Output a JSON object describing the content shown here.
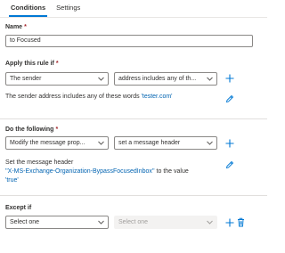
{
  "tabs": [
    {
      "label": "Conditions"
    },
    {
      "label": "Settings"
    }
  ],
  "name": {
    "label": "Name",
    "required": "*",
    "value": "to Focused"
  },
  "apply_rule": {
    "label": "Apply this rule if",
    "required": "*",
    "field1": "The sender",
    "field2": "address includes any of th...",
    "desc_prefix": "The sender address includes any of these words",
    "desc_value": "'tester.com'"
  },
  "do_following": {
    "label": "Do the following",
    "required": "*",
    "field1": "Modify the message prop...",
    "field2": "set a message header",
    "desc_line1_prefix": "Set the message header",
    "desc_header": "''X-MS-Exchange-Organization-BypassFocusedInbox''",
    "desc_to_value": "to the value",
    "desc_value": "'true'"
  },
  "except_if": {
    "label": "Except if",
    "field1": "Select one",
    "field2": "Select one"
  },
  "icons": {
    "accent": "#0078d4",
    "add": "plus-icon",
    "edit": "pencil-icon",
    "delete": "trash-icon",
    "dropdown": "chevron-down-icon"
  }
}
